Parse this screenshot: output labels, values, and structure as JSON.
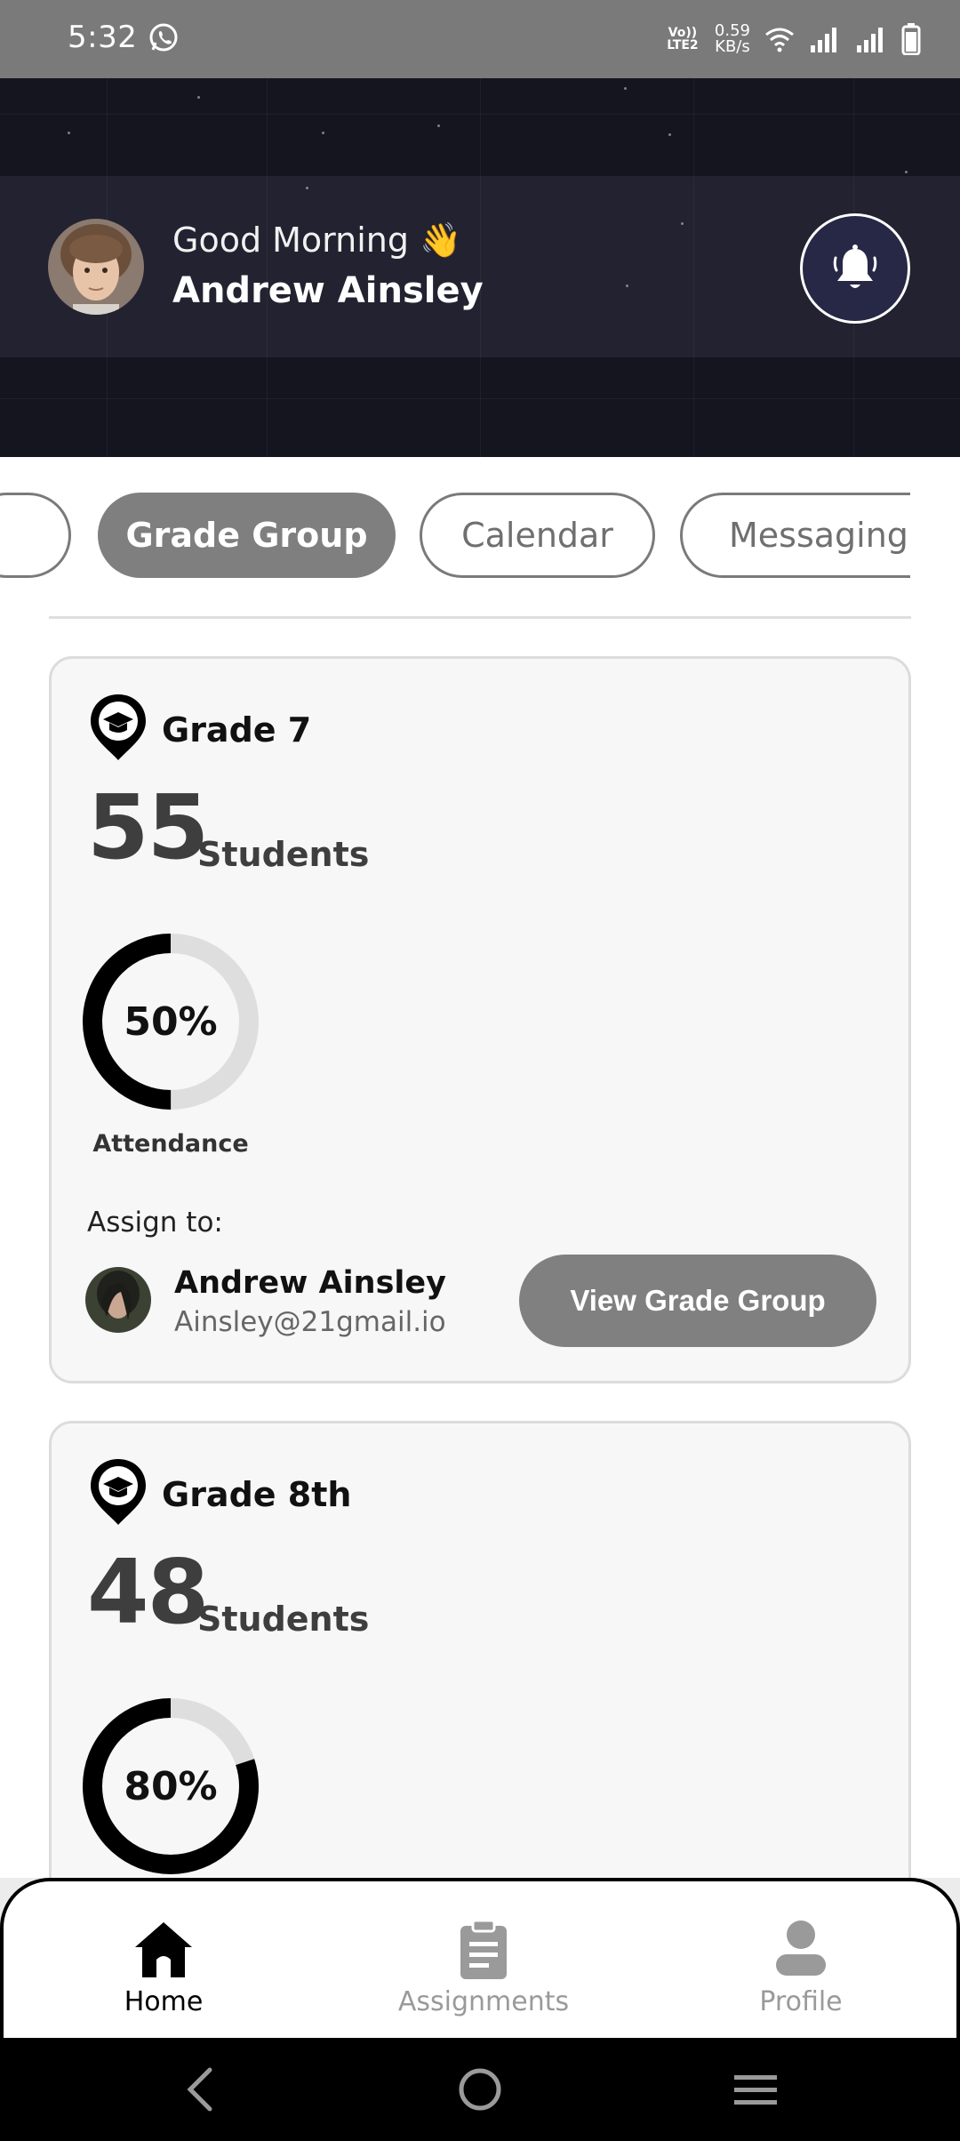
{
  "status_bar": {
    "time": "5:32",
    "network_label_1": "Vo)) LTE2",
    "speed_value": "0.59",
    "speed_unit": "KB/s",
    "icons": [
      "whatsapp-icon",
      "wifi-icon",
      "signal-icon",
      "signal-icon",
      "battery-icon"
    ]
  },
  "header": {
    "greeting": "Good Morning 👋",
    "user_name": "Andrew Ainsley",
    "bell_icon": "bell-ringing-icon"
  },
  "tabs": {
    "items": [
      {
        "label": "Grade Group",
        "active": true
      },
      {
        "label": "Calendar",
        "active": false
      },
      {
        "label": "Messaging",
        "active": false
      }
    ]
  },
  "grade_cards": [
    {
      "title": "Grade 7",
      "student_count": "55",
      "student_label": "Students",
      "attendance_percent": 50,
      "attendance_text": "50%",
      "attendance_label": "Attendance",
      "assign_label": "Assign to:",
      "assignee_name": "Andrew Ainsley",
      "assignee_email": "Ainsley@21gmail.io",
      "button_label": "View Grade Group"
    },
    {
      "title": "Grade 8th",
      "student_count": "48",
      "student_label": "Students",
      "attendance_percent": 80,
      "attendance_text": "80%"
    }
  ],
  "bottom_nav": {
    "items": [
      {
        "label": "Home",
        "icon": "home-icon",
        "active": true
      },
      {
        "label": "Assignments",
        "icon": "clipboard-icon",
        "active": false
      },
      {
        "label": "Profile",
        "icon": "person-icon",
        "active": false
      }
    ]
  },
  "colors": {
    "header_bg": "#15151f",
    "active_chip": "#7f7f7f",
    "ring_progress": "#000000",
    "ring_track": "#dedede"
  }
}
